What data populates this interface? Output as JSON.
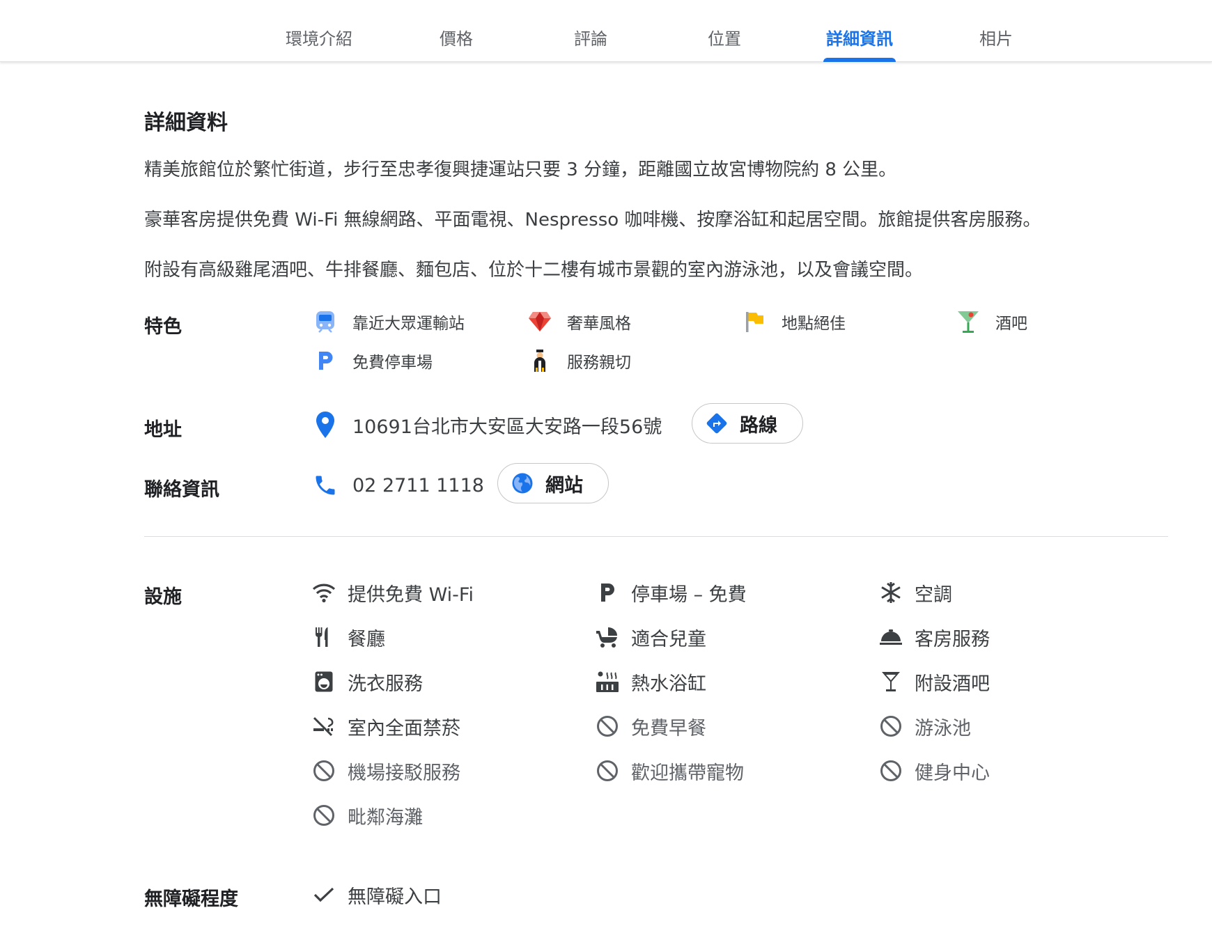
{
  "tabs": [
    {
      "label": "環境介紹",
      "active": false
    },
    {
      "label": "價格",
      "active": false
    },
    {
      "label": "評論",
      "active": false
    },
    {
      "label": "位置",
      "active": false
    },
    {
      "label": "詳細資訊",
      "active": true
    },
    {
      "label": "相片",
      "active": false
    }
  ],
  "details": {
    "title": "詳細資料",
    "paragraphs": [
      "精美旅館位於繁忙街道，步行至忠孝復興捷運站只要 3 分鐘，距離國立故宮博物院約 8 公里。",
      "豪華客房提供免費 Wi-Fi 無線網路、平面電視、Nespresso 咖啡機、按摩浴缸和起居空間。旅館提供客房服務。",
      "附設有高級雞尾酒吧、牛排餐廳、麵包店、位於十二樓有城市景觀的室內游泳池，以及會議空間。"
    ]
  },
  "features": {
    "label": "特色",
    "items": [
      {
        "label": "靠近大眾運輸站",
        "icon": "train-icon"
      },
      {
        "label": "奢華風格",
        "icon": "gem-icon"
      },
      {
        "label": "地點絕佳",
        "icon": "flag-icon"
      },
      {
        "label": "酒吧",
        "icon": "cocktail-icon"
      },
      {
        "label": "免費停車場",
        "icon": "parking-icon"
      },
      {
        "label": "服務親切",
        "icon": "bellhop-icon"
      }
    ]
  },
  "address": {
    "label": "地址",
    "value": "10691台北市大安區大安路一段56號",
    "directions_label": "路線"
  },
  "contact": {
    "label": "聯絡資訊",
    "phone": "02 2711 1118",
    "website_label": "網站"
  },
  "amenities": {
    "label": "設施",
    "items": [
      {
        "label": "提供免費 Wi-Fi",
        "icon": "wifi-icon",
        "available": true
      },
      {
        "label": "停車場 – 免費",
        "icon": "parking-icon",
        "available": true
      },
      {
        "label": "空調",
        "icon": "snowflake-icon",
        "available": true
      },
      {
        "label": "餐廳",
        "icon": "restaurant-icon",
        "available": true
      },
      {
        "label": "適合兒童",
        "icon": "stroller-icon",
        "available": true
      },
      {
        "label": "客房服務",
        "icon": "room-service-icon",
        "available": true
      },
      {
        "label": "洗衣服務",
        "icon": "laundry-icon",
        "available": true
      },
      {
        "label": "熱水浴缸",
        "icon": "hot-tub-icon",
        "available": true
      },
      {
        "label": "附設酒吧",
        "icon": "bar-icon",
        "available": true
      },
      {
        "label": "室內全面禁菸",
        "icon": "no-smoking-icon",
        "available": true
      },
      {
        "label": "免費早餐",
        "icon": "not-available-icon",
        "available": false
      },
      {
        "label": "游泳池",
        "icon": "not-available-icon",
        "available": false
      },
      {
        "label": "機場接駁服務",
        "icon": "not-available-icon",
        "available": false
      },
      {
        "label": "歡迎攜帶寵物",
        "icon": "not-available-icon",
        "available": false
      },
      {
        "label": "健身中心",
        "icon": "not-available-icon",
        "available": false
      },
      {
        "label": "毗鄰海灘",
        "icon": "not-available-icon",
        "available": false
      }
    ]
  },
  "accessibility": {
    "label": "無障礙程度",
    "items": [
      {
        "label": "無障礙入口",
        "icon": "check-icon"
      }
    ]
  },
  "colors": {
    "accent": "#1a73e8",
    "text": "#3c4043",
    "heading": "#202124",
    "muted": "#5f6368",
    "divider": "#dadce0"
  }
}
